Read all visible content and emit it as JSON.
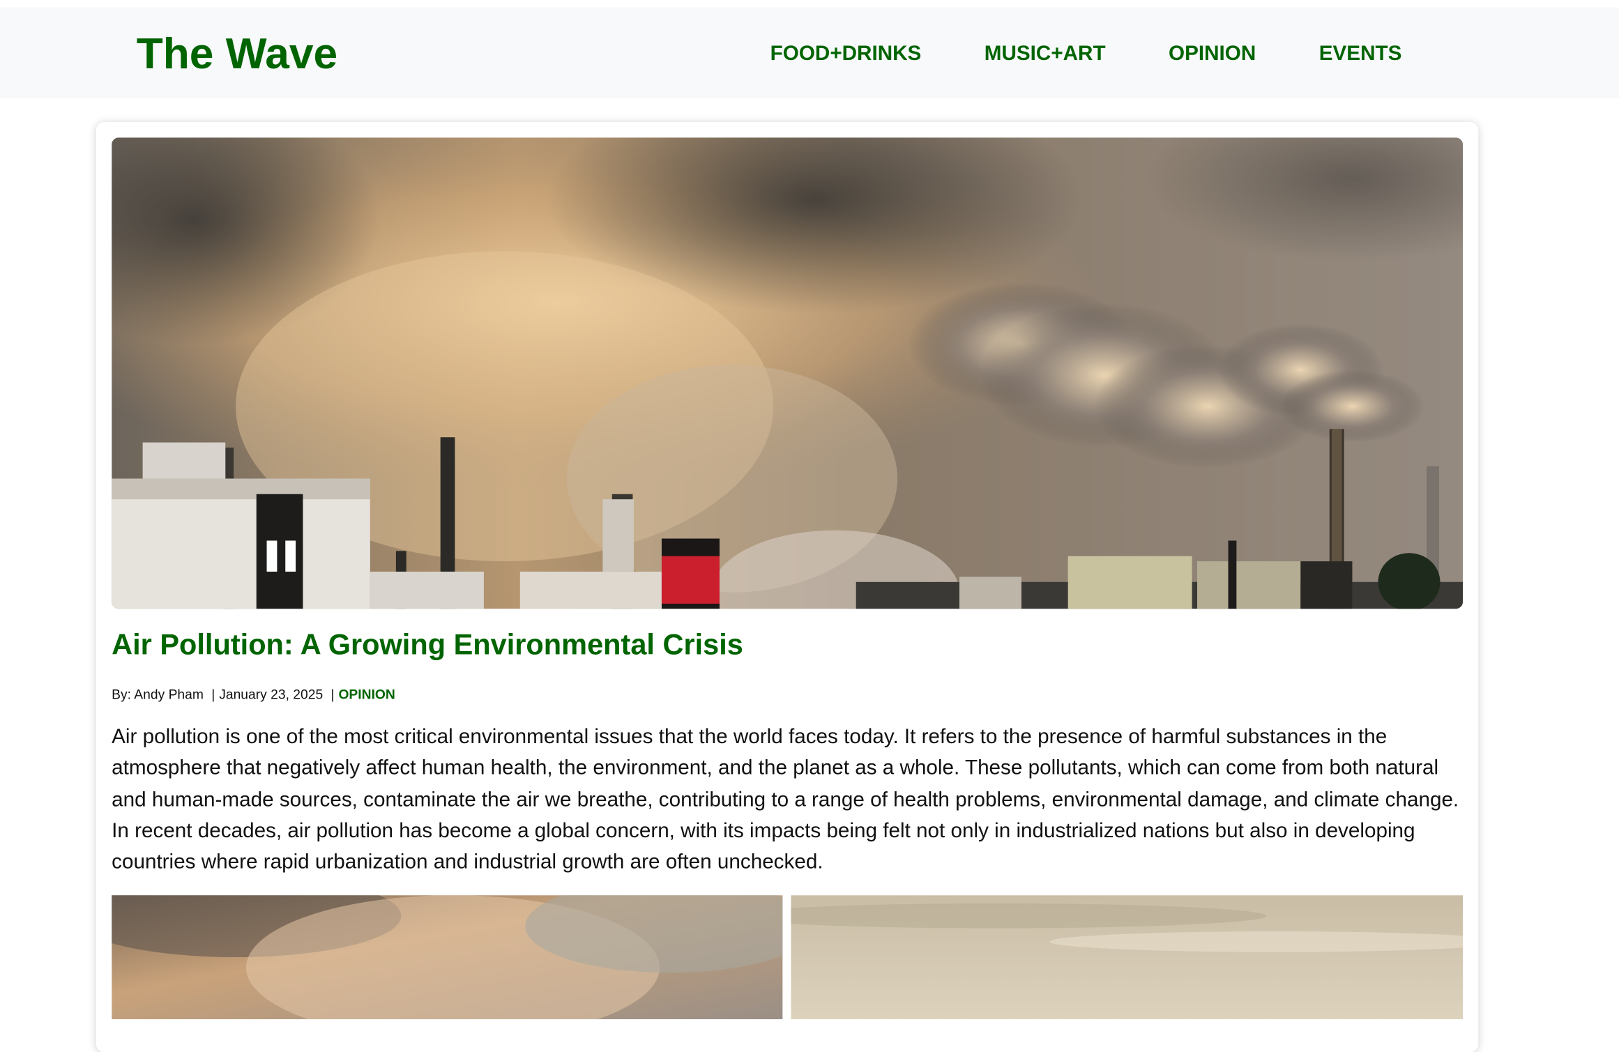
{
  "site": {
    "brand": "The Wave",
    "nav": [
      {
        "label": "FOOD+DRINKS"
      },
      {
        "label": "MUSIC+ART"
      },
      {
        "label": "OPINION"
      },
      {
        "label": "EVENTS"
      }
    ]
  },
  "article": {
    "title": "Air Pollution: A Growing Environmental Crisis",
    "byline": "By: Andy Pham",
    "date": "January 23, 2025",
    "category": "OPINION",
    "separator": "|",
    "body": "Air pollution is one of the most critical environmental issues that the world faces today. It refers to the presence of harmful substances in the atmosphere that negatively affect human health, the environment, and the planet as a whole. These pollutants, which can come from both natural and human-made sources, contaminate the air we breathe, contributing to a range of health problems, environmental damage, and climate change. In recent decades, air pollution has become a global concern, with its impacts being felt not only in industrialized nations but also in developing countries where rapid urbanization and industrial growth are often unchecked."
  },
  "colors": {
    "brand_green": "#006400",
    "header_bg": "#f8f9fa",
    "text": "#111111"
  }
}
